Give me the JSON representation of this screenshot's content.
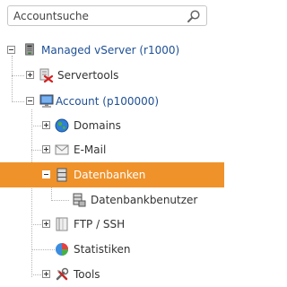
{
  "search": {
    "placeholder": "Accountsuche",
    "value": ""
  },
  "tree": {
    "server": {
      "label": "Managed vServer (r1000)"
    },
    "servertools": {
      "label": "Servertools"
    },
    "account": {
      "label": "Account (p100000)"
    },
    "domains": {
      "label": "Domains"
    },
    "email": {
      "label": "E-Mail"
    },
    "datenbanken": {
      "label": "Datenbanken"
    },
    "datenbankbenutzer": {
      "label": "Datenbankbenutzer"
    },
    "ftp": {
      "label": "FTP / SSH"
    },
    "statistiken": {
      "label": "Statistiken"
    },
    "tools": {
      "label": "Tools"
    }
  },
  "colors": {
    "selected": "#f0922a",
    "link": "#1d4f96"
  }
}
